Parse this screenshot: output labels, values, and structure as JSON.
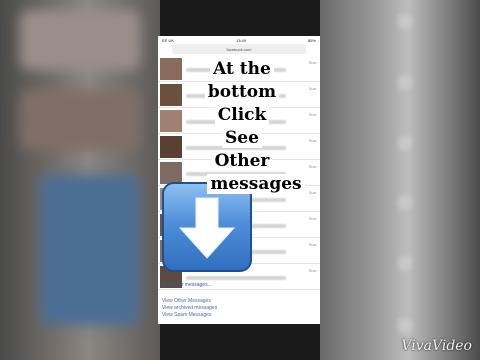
{
  "status_bar": {
    "carrier": "EE UK",
    "time": "13:49",
    "battery": "85%"
  },
  "browser": {
    "url": "facebook.com"
  },
  "messages": [
    {
      "date": "Sun"
    },
    {
      "date": "Sun"
    },
    {
      "date": "Sun"
    },
    {
      "date": "Sun"
    },
    {
      "date": "Sun"
    },
    {
      "date": "Sun"
    },
    {
      "date": "Sun"
    },
    {
      "date": "Sun"
    },
    {
      "date": "Sun"
    }
  ],
  "older_link": "See older messages...",
  "footer_links": [
    "View Other Messages",
    "View archived messages",
    "View Spam Messages"
  ],
  "caption_lines": [
    "At the",
    "bottom",
    "Click",
    "See",
    "Other",
    "messages"
  ],
  "watermark": "VivaVideo",
  "colors": {
    "arrow_blue": "#4f8fd8",
    "link_blue": "#2a5db0"
  },
  "icons": {
    "arrow": "down-arrow-icon"
  }
}
